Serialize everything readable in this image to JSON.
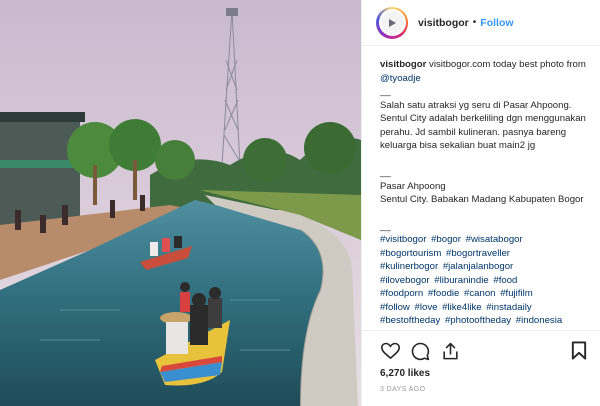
{
  "profile": {
    "username": "visitbogor",
    "follow_label": "Follow",
    "dot": "•"
  },
  "caption": {
    "username": "visitbogor",
    "intro": "visitbogor.com today best photo from",
    "mention": "@tyoadje",
    "divider1": "__",
    "para1": "Salah satu atraksi yg seru di Pasar Ahpoong. Sentul City adalah berkeliling dgn menggunakan perahu. Jd sambil kulineran. pasnya bareng keluarga bisa sekalian buat main2 jg",
    "divider2": "__",
    "location_line1": "Pasar Ahpoong",
    "location_line2": "Sentul City. Babakan Madang Kabupaten Bogor",
    "divider3": "__",
    "hashtags": [
      "#visitbogor",
      "#bogor",
      "#wisatabogor",
      "#bogortourism",
      "#bogortraveller",
      "#kulinerbogor",
      "#jalanjalanbogor",
      "#ilovebogor",
      "#liburanindie",
      "#food",
      "#foodporn",
      "#foodie",
      "#canon",
      "#fujifilm",
      "#follow",
      "#love",
      "#like4like",
      "#instadaily",
      "#bestoftheday",
      "#photooftheday",
      "#indonesia"
    ]
  },
  "footer": {
    "likes": "6,270 likes",
    "time": "3 DAYS AGO"
  },
  "icons": {
    "heart": "heart-icon",
    "comment": "comment-icon",
    "share": "share-icon",
    "bookmark": "bookmark-icon"
  },
  "colors": {
    "follow_blue": "#3897f0",
    "hashtag_blue": "#003569",
    "muted_gray": "#999999"
  }
}
